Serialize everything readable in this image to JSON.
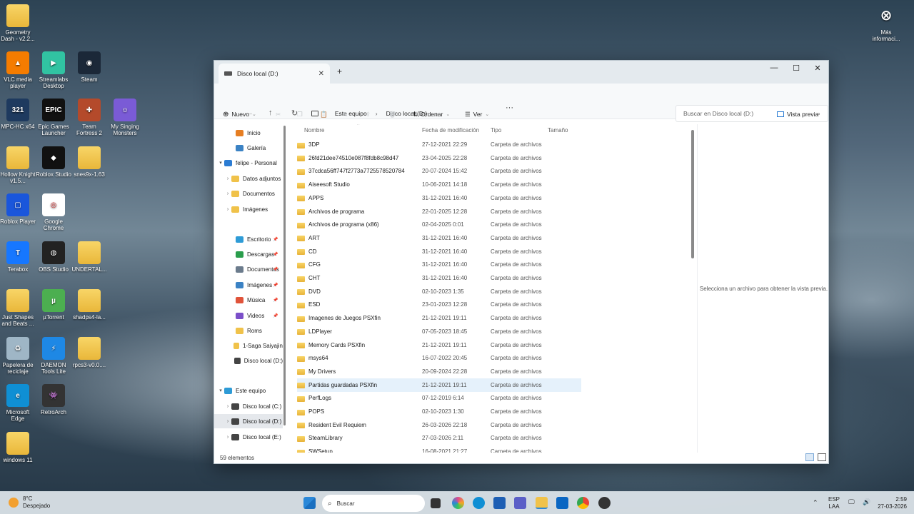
{
  "desktop": {
    "icons": [
      {
        "label": "Geometry Dash - v2.2...",
        "type": "folder"
      },
      {
        "label": "VLC media player",
        "type": "app",
        "color": "#f57c00",
        "glyph": "▲"
      },
      {
        "label": "Streamlabs Desktop",
        "type": "app",
        "color": "#31c3a2",
        "glyph": "▶"
      },
      {
        "label": "Steam",
        "type": "app",
        "color": "#1b2838",
        "glyph": "◉"
      },
      {
        "label": "MPC-HC x64",
        "type": "app",
        "color": "#1e3a5f",
        "glyph": "321"
      },
      {
        "label": "Epic Games Launcher",
        "type": "app",
        "color": "#111111",
        "glyph": "EPIC"
      },
      {
        "label": "Team Fortress 2",
        "type": "app",
        "color": "#b44a2b",
        "glyph": "✚"
      },
      {
        "label": "My Singing Monsters",
        "type": "app",
        "color": "#7a5bd6",
        "glyph": "☺"
      },
      {
        "label": "Hollow Knight v1.5...",
        "type": "folder"
      },
      {
        "label": "Roblox Studio",
        "type": "app",
        "color": "#111111",
        "glyph": "◆"
      },
      {
        "label": "snes9x-1.63",
        "type": "folder"
      },
      {
        "label": "Roblox Player",
        "type": "app",
        "color": "#1a56db",
        "glyph": "▢"
      },
      {
        "label": "Google Chrome",
        "type": "app",
        "color": "#ffffff",
        "glyph": "◎"
      },
      {
        "label": "Terabox",
        "type": "app",
        "color": "#1677ff",
        "glyph": "T"
      },
      {
        "label": "OBS Studio",
        "type": "app",
        "color": "#222222",
        "glyph": "◍"
      },
      {
        "label": "UNDERTAL...",
        "type": "folder"
      },
      {
        "label": "Just Shapes and Beats ...",
        "type": "folder"
      },
      {
        "label": "µTorrent",
        "type": "app",
        "color": "#4caf50",
        "glyph": "µ"
      },
      {
        "label": "shadps4-la...",
        "type": "folder"
      },
      {
        "label": "Papelera de reciclaje",
        "type": "app",
        "color": "#9fb6c6",
        "glyph": "♻"
      },
      {
        "label": "DAEMON Tools Lite",
        "type": "app",
        "color": "#1e88e5",
        "glyph": "⚡"
      },
      {
        "label": "rpcs3-v0.0....",
        "type": "folder"
      },
      {
        "label": "Microsoft Edge",
        "type": "app",
        "color": "#0f8fd4",
        "glyph": "e"
      },
      {
        "label": "RetroArch",
        "type": "app",
        "color": "#333333",
        "glyph": "👾"
      },
      {
        "label": "windows 11",
        "type": "folder"
      },
      {
        "label": "Más informaci...",
        "type": "app",
        "color": "transparent",
        "glyph": "⊗"
      }
    ]
  },
  "window": {
    "tab_title": "Disco local (D:)",
    "breadcrumb": [
      "Este equipo",
      "Disco local (D:)"
    ],
    "search_placeholder": "Buscar en Disco local (D:)",
    "toolbar": {
      "new": "Nuevo",
      "sort": "Ordenar",
      "view": "Ver",
      "more": "···",
      "preview": "Vista previa"
    },
    "nav": [
      {
        "label": "Inicio",
        "icon": "home-icon",
        "color": "#e67e22",
        "chev": ""
      },
      {
        "label": "Galería",
        "icon": "gallery-icon",
        "color": "#3b82c4",
        "chev": ""
      },
      {
        "label": "felipe - Personal",
        "icon": "cloud-icon",
        "color": "#2b7cd3",
        "chev": "▾"
      },
      {
        "label": "Datos adjuntos",
        "icon": "folder-icon",
        "color": "#f0c24a",
        "chev": "›"
      },
      {
        "label": "Documentos",
        "icon": "folder-icon",
        "color": "#f0c24a",
        "chev": "›"
      },
      {
        "label": "Imágenes",
        "icon": "folder-icon",
        "color": "#f0c24a",
        "chev": "›"
      },
      {
        "label": "Escritorio",
        "icon": "desktop-icon",
        "color": "#2e9bd6",
        "chev": "",
        "pin": true
      },
      {
        "label": "Descargas",
        "icon": "download-icon",
        "color": "#2a9d4c",
        "chev": "",
        "pin": true
      },
      {
        "label": "Documentos",
        "icon": "documents-icon",
        "color": "#6b7b8c",
        "chev": "",
        "pin": true
      },
      {
        "label": "Imágenes",
        "icon": "pictures-icon",
        "color": "#3b82c4",
        "chev": "",
        "pin": true
      },
      {
        "label": "Música",
        "icon": "music-icon",
        "color": "#e0533a",
        "chev": "",
        "pin": true
      },
      {
        "label": "Videos",
        "icon": "videos-icon",
        "color": "#7b4fc9",
        "chev": "",
        "pin": true
      },
      {
        "label": "Roms",
        "icon": "folder-icon",
        "color": "#f0c24a",
        "chev": ""
      },
      {
        "label": "1-Saga Saiyajin",
        "icon": "folder-icon",
        "color": "#f0c24a",
        "chev": ""
      },
      {
        "label": "Disco local (D:)",
        "icon": "drive-icon",
        "color": "#444444",
        "chev": ""
      },
      {
        "label": "Este equipo",
        "icon": "computer-icon",
        "color": "#2e9bd6",
        "chev": "▾"
      },
      {
        "label": "Disco local (C:)",
        "icon": "drive-icon",
        "color": "#444444",
        "chev": "›"
      },
      {
        "label": "Disco local (D:)",
        "icon": "drive-icon",
        "color": "#444444",
        "chev": "›",
        "selected": true
      },
      {
        "label": "Disco local (E:)",
        "icon": "drive-icon",
        "color": "#444444",
        "chev": "›"
      }
    ],
    "columns": [
      "Nombre",
      "Fecha de modificación",
      "Tipo",
      "Tamaño"
    ],
    "files": [
      {
        "name": "3DP",
        "date": "27-12-2021 22:29",
        "type": "Carpeta de archivos"
      },
      {
        "name": "26fd21dee74510e087f8fdb8c98d47",
        "date": "23-04-2025 22:28",
        "type": "Carpeta de archivos"
      },
      {
        "name": "37cdca56ff747f2773a7725578520784",
        "date": "20-07-2024 15:42",
        "type": "Carpeta de archivos"
      },
      {
        "name": "Aiseesoft Studio",
        "date": "10-06-2021 14:18",
        "type": "Carpeta de archivos"
      },
      {
        "name": "APPS",
        "date": "31-12-2021 16:40",
        "type": "Carpeta de archivos"
      },
      {
        "name": "Archivos de programa",
        "date": "22-01-2025 12:28",
        "type": "Carpeta de archivos"
      },
      {
        "name": "Archivos de programa (x86)",
        "date": "02-04-2025 0:01",
        "type": "Carpeta de archivos"
      },
      {
        "name": "ART",
        "date": "31-12-2021 16:40",
        "type": "Carpeta de archivos"
      },
      {
        "name": "CD",
        "date": "31-12-2021 16:40",
        "type": "Carpeta de archivos"
      },
      {
        "name": "CFG",
        "date": "31-12-2021 16:40",
        "type": "Carpeta de archivos"
      },
      {
        "name": "CHT",
        "date": "31-12-2021 16:40",
        "type": "Carpeta de archivos"
      },
      {
        "name": "DVD",
        "date": "02-10-2023 1:35",
        "type": "Carpeta de archivos"
      },
      {
        "name": "ESD",
        "date": "23-01-2023 12:28",
        "type": "Carpeta de archivos"
      },
      {
        "name": "Imagenes de Juegos PSXfin",
        "date": "21-12-2021 19:11",
        "type": "Carpeta de archivos"
      },
      {
        "name": "LDPlayer",
        "date": "07-05-2023 18:45",
        "type": "Carpeta de archivos"
      },
      {
        "name": "Memory Cards PSXfin",
        "date": "21-12-2021 19:11",
        "type": "Carpeta de archivos"
      },
      {
        "name": "msys64",
        "date": "16-07-2022 20:45",
        "type": "Carpeta de archivos"
      },
      {
        "name": "My Drivers",
        "date": "20-09-2024 22:28",
        "type": "Carpeta de archivos"
      },
      {
        "name": "Partidas guardadas PSXfin",
        "date": "21-12-2021 19:11",
        "type": "Carpeta de archivos",
        "hover": true
      },
      {
        "name": "PerfLogs",
        "date": "07-12-2019 6:14",
        "type": "Carpeta de archivos"
      },
      {
        "name": "POPS",
        "date": "02-10-2023 1:30",
        "type": "Carpeta de archivos"
      },
      {
        "name": "Resident Evil Requiem",
        "date": "26-03-2026 22:18",
        "type": "Carpeta de archivos"
      },
      {
        "name": "SteamLibrary",
        "date": "27-03-2026 2:11",
        "type": "Carpeta de archivos"
      },
      {
        "name": "SWSetup",
        "date": "16-08-2021 21:27",
        "type": "Carpeta de archivos"
      }
    ],
    "preview_text": "Selecciona un archivo para obtener la vista previa.",
    "status": "59 elementos"
  },
  "taskbar": {
    "weather_temp": "8°C",
    "weather_desc": "Despejado",
    "search_placeholder": "Buscar",
    "lang1": "ESP",
    "lang2": "LAA",
    "time": "2:59",
    "date": "27-03-2026"
  }
}
